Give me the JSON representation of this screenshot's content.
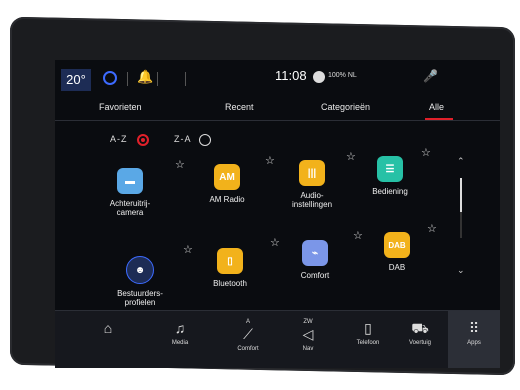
{
  "status": {
    "temperature": "20°",
    "time": "11:08",
    "battery": "100% NL"
  },
  "tabs": [
    {
      "label": "Favorieten"
    },
    {
      "label": "Recent"
    },
    {
      "label": "Categorieën"
    },
    {
      "label": "Alle",
      "active": true
    }
  ],
  "sort": {
    "az": "A-Z",
    "za": "Z-A",
    "selected": "A-Z"
  },
  "apps": [
    {
      "label": "Achteruitrij-\ncamera",
      "icon": "camera-icon",
      "color": "#5aa8e6"
    },
    {
      "label": "AM Radio",
      "icon": "am-radio-icon",
      "icon_text": "AM",
      "color": "#f2b21b"
    },
    {
      "label": "Audio-\ninstellingen",
      "icon": "audio-settings-icon",
      "color": "#f2b21b"
    },
    {
      "label": "Bediening",
      "icon": "controls-icon",
      "color": "#27c1a6"
    },
    {
      "label": "Bestuurders-\nprofielen",
      "icon": "driver-profile-icon",
      "color": "#1d2c55"
    },
    {
      "label": "Bluetooth",
      "icon": "bluetooth-phone-icon",
      "color": "#f2b21b"
    },
    {
      "label": "Comfort",
      "icon": "comfort-icon",
      "color": "#7b96e8"
    },
    {
      "label": "DAB",
      "icon": "dab-icon",
      "icon_text": "DAB",
      "color": "#f2b21b"
    }
  ],
  "nav": [
    {
      "label": "",
      "icon": "home-icon"
    },
    {
      "label": "Media",
      "icon": "music-note-icon"
    },
    {
      "label": "Comfort",
      "icon": "seat-icon",
      "top": "A"
    },
    {
      "label": "Nav",
      "icon": "navigation-arrow-icon",
      "top": "ZW"
    },
    {
      "label": "Telefoon",
      "icon": "phone-icon"
    },
    {
      "label": "Voertuig",
      "icon": "car-icon"
    },
    {
      "label": "Apps",
      "icon": "apps-grid-icon",
      "active": true
    }
  ]
}
